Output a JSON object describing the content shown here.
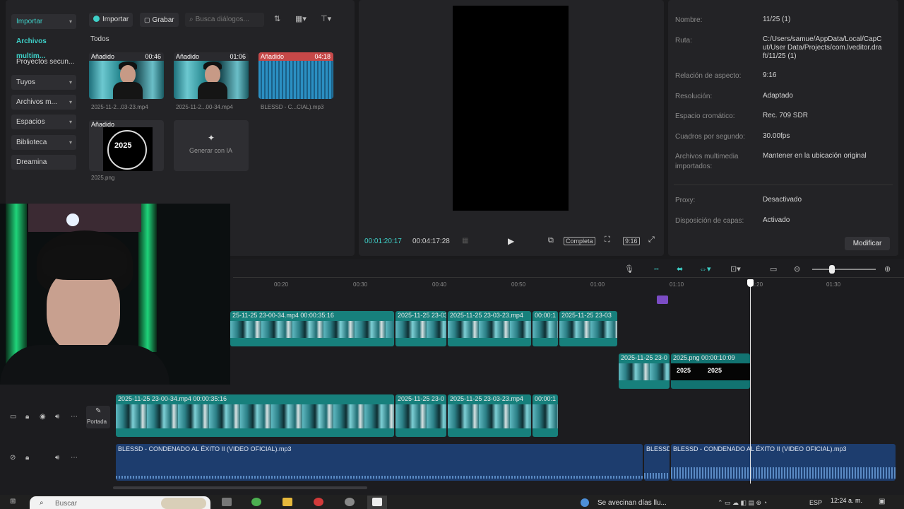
{
  "sidebar": {
    "items": [
      {
        "label": "Importar",
        "has_menu": true
      },
      {
        "label": "Archivos multim...",
        "has_menu": false
      },
      {
        "label": "Proyectos secun...",
        "has_menu": false
      },
      {
        "label": "Tuyos",
        "has_menu": true
      },
      {
        "label": "Archivos m...",
        "has_menu": true
      },
      {
        "label": "Espacios",
        "has_menu": true
      },
      {
        "label": "Biblioteca",
        "has_menu": true
      },
      {
        "label": "Dreamina",
        "has_menu": false
      }
    ]
  },
  "media": {
    "import_label": "Importar",
    "record_label": "Grabar",
    "search_placeholder": "Busca diálogos...",
    "section_label": "Todos",
    "items": [
      {
        "tag": "Añadido",
        "duration": "00:46",
        "caption": "2025-11-2...03-23.mp4",
        "kind": "video"
      },
      {
        "tag": "Añadido",
        "duration": "01:06",
        "caption": "2025-11-2...00-34.mp4",
        "kind": "video"
      },
      {
        "tag": "Añadido",
        "duration": "04:18",
        "caption": "BLESSD - C...CIAL).mp3",
        "kind": "audio"
      },
      {
        "tag": "Añadido",
        "duration": "",
        "caption": "2025.png",
        "kind": "image",
        "image_text": "2025"
      },
      {
        "tag": "",
        "duration": "",
        "caption": "Generar con IA",
        "kind": "generate"
      }
    ]
  },
  "player": {
    "current_time": "00:01:20:17",
    "total_time": "00:04:17:28",
    "full_label": "Completa",
    "ratio_label": "9:16"
  },
  "details": {
    "rows": [
      {
        "label": "Nombre:",
        "value": "11/25 (1)"
      },
      {
        "label": "Ruta:",
        "value": "C:/Users/samue/AppData/Local/CapCut/User Data/Projects/com.lveditor.draft/11/25 (1)"
      },
      {
        "label": "Relación de aspecto:",
        "value": "9:16"
      },
      {
        "label": "Resolución:",
        "value": "Adaptado"
      },
      {
        "label": "Espacio cromático:",
        "value": "Rec. 709 SDR"
      },
      {
        "label": "Cuadros por segundo:",
        "value": "30.00fps"
      },
      {
        "label": "Archivos multimedia importados:",
        "value": "Mantener en la ubicación original"
      },
      {
        "label": "Proxy:",
        "value": "Desactivado"
      },
      {
        "label": "Disposición de capas:",
        "value": "Activado"
      }
    ],
    "modify_label": "Modificar"
  },
  "timeline": {
    "ruler": [
      "00:20",
      "00:30",
      "00:40",
      "00:50",
      "01:00",
      "01:10",
      "01:20",
      "01:30"
    ],
    "upper_clips": [
      "25-11-25 23-00-34.mp4 00:00:35:16",
      "2025-11-25 23-03",
      "2025-11-25 23-03-23.mp4",
      "00:00:1",
      "2025-11-25 23-03"
    ],
    "overlay_clips": [
      "2025-11-25 23-0",
      "2025.png  00:00:10:09"
    ],
    "main_clips": [
      "2025-11-25 23-00-34.mp4  00:00:35:16",
      "2025-11-25 23-0",
      "2025-11-25 23-03-23.mp4",
      "00:00:1"
    ],
    "cover_label": "Portada",
    "audio_clips": [
      "BLESSD - CONDENADO AL ÉXITO II  (VIDEO OFICIAL).mp3",
      "BLESSD",
      "BLESSD - CONDENADO AL ÉXITO II  (VIDEO OFICIAL).mp3"
    ],
    "image_clip_text": "2025"
  },
  "taskbar": {
    "search_placeholder": "Buscar",
    "news": "Se avecinan días llu...",
    "lang": "ESP",
    "time": "12:24 a. m."
  }
}
